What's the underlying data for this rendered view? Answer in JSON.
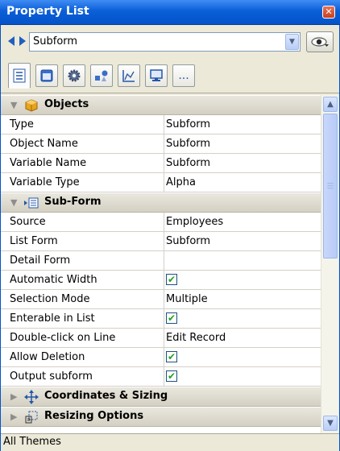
{
  "window": {
    "title": "Property List"
  },
  "selector": {
    "value": "Subform"
  },
  "tabs": [
    {
      "name": "list-view-tab",
      "icon": "list-icon",
      "active": true
    },
    {
      "name": "object-tab",
      "icon": "window-icon"
    },
    {
      "name": "settings-tab",
      "icon": "gear-icon"
    },
    {
      "name": "shapes-tab",
      "icon": "shapes-icon"
    },
    {
      "name": "graph-tab",
      "icon": "graph-icon"
    },
    {
      "name": "display-tab",
      "icon": "monitor-icon"
    },
    {
      "name": "more-tab",
      "icon": "ellipsis-icon",
      "label": "..."
    }
  ],
  "sections": {
    "objects": {
      "label": "Objects",
      "rows": [
        {
          "name": "Type",
          "value": "Subform"
        },
        {
          "name": "Object Name",
          "value": "Subform"
        },
        {
          "name": "Variable Name",
          "value": "Subform"
        },
        {
          "name": "Variable Type",
          "value": "Alpha"
        }
      ]
    },
    "subform": {
      "label": "Sub-Form",
      "rows": [
        {
          "name": "Source",
          "value": "Employees"
        },
        {
          "name": "List Form",
          "value": "Subform"
        },
        {
          "name": "Detail Form",
          "value": ""
        },
        {
          "name": "Automatic Width",
          "checked": true,
          "check_mark": "✔"
        },
        {
          "name": "Selection Mode",
          "value": "Multiple"
        },
        {
          "name": "Enterable in List",
          "checked": true,
          "check_mark": "✔"
        },
        {
          "name": "Double-click on Line",
          "value": "Edit Record"
        },
        {
          "name": "Allow Deletion",
          "checked": true,
          "check_mark": "✔"
        },
        {
          "name": "Output subform",
          "checked": true,
          "check_mark": "✔"
        }
      ]
    },
    "coordinates": {
      "label": "Coordinates & Sizing"
    },
    "resizing": {
      "label": "Resizing Options"
    }
  },
  "status": {
    "text": "All Themes"
  },
  "colors": {
    "title_bar": "#0553c9",
    "check_green": "#21a121",
    "section_bg": "#d4d0c2"
  }
}
